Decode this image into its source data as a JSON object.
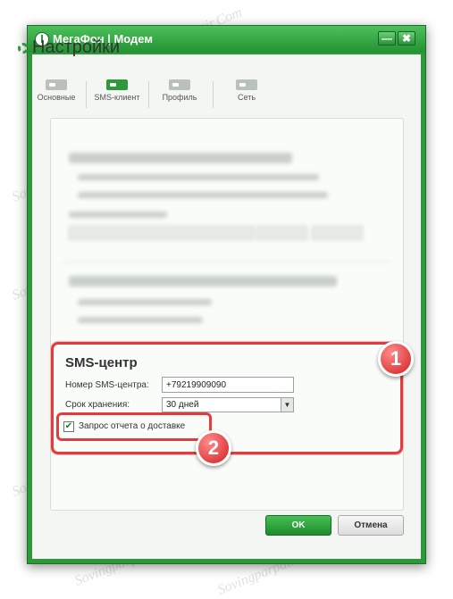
{
  "window": {
    "title": "МегаФон | Модем",
    "minimize_label": "—",
    "close_label": "✖"
  },
  "page": {
    "title": "Настройки"
  },
  "tabs": [
    {
      "label": "Основные",
      "icon": "sim-card-icon"
    },
    {
      "label": "SMS-клиент",
      "icon": "sim-card-icon",
      "active": true
    },
    {
      "label": "Профиль",
      "icon": "sim-card-icon"
    },
    {
      "label": "Сеть",
      "icon": "sim-card-icon"
    }
  ],
  "sms_center": {
    "title": "SMS-центр",
    "number_label": "Номер SMS-центра:",
    "number_value": "+79219909090",
    "storage_label": "Срок хранения:",
    "storage_value": "30 дней",
    "delivery_report_label": "Запрос отчета о доставке",
    "delivery_report_checked": true
  },
  "annotations": {
    "badge_1": "1",
    "badge_2": "2"
  },
  "buttons": {
    "ok": "OK",
    "cancel": "Отмена"
  },
  "watermark": "Sovingparpair.Com",
  "colors": {
    "accent": "#2d9a3a",
    "highlight": "#e43c3c"
  }
}
